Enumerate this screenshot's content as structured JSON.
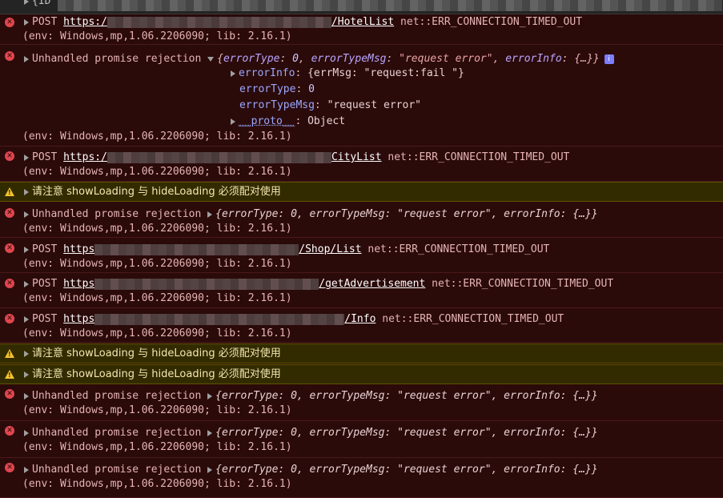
{
  "top_row": {
    "text": "{ID"
  },
  "messages": [
    {
      "type": "error",
      "method": "POST",
      "url_prefix": "https:/",
      "url_suffix": "/HotelList",
      "status": "net::ERR_CONNECTION_TIMED_OUT",
      "env": "(env: Windows,mp,1.06.2206090; lib: 2.16.1)"
    },
    {
      "type": "error",
      "label": "Unhandled promise rejection",
      "summary": {
        "open": "{",
        "k1": "errorType",
        "v1": "0",
        "k2": "errorTypeMsg",
        "v2": "\"request error\"",
        "k3": "errorInfo",
        "v3": "{…}",
        "close": "}"
      },
      "info_icon": "i",
      "expanded": [
        {
          "key": "errorInfo",
          "value": "{errMsg: \"request:fail \"}"
        },
        {
          "key": "errorType",
          "value": "0"
        },
        {
          "key": "errorTypeMsg",
          "value": "\"request error\""
        },
        {
          "key": "__proto__",
          "value": "Object"
        }
      ],
      "env": "(env: Windows,mp,1.06.2206090; lib: 2.16.1)"
    },
    {
      "type": "error",
      "method": "POST",
      "url_prefix": "https:/",
      "url_suffix": "CityList",
      "status": "net::ERR_CONNECTION_TIMED_OUT",
      "env": "(env: Windows,mp,1.06.2206090; lib: 2.16.1)"
    },
    {
      "type": "warning",
      "text": "请注意 showLoading 与 hideLoading 必须配对使用"
    },
    {
      "type": "error",
      "label": "Unhandled promise rejection",
      "summary": "{errorType: 0, errorTypeMsg: \"request error\", errorInfo: {…}}",
      "env": "(env: Windows,mp,1.06.2206090; lib: 2.16.1)"
    },
    {
      "type": "error",
      "method": "POST",
      "url_prefix": "https",
      "url_suffix": "/Shop/List",
      "status": "net::ERR_CONNECTION_TIMED_OUT",
      "env": "(env: Windows,mp,1.06.2206090; lib: 2.16.1)"
    },
    {
      "type": "error",
      "method": "POST",
      "url_prefix": "https",
      "url_suffix": "/getAdvertisement",
      "status": "net::ERR_CONNECTION_TIMED_OUT",
      "env": "(env: Windows,mp,1.06.2206090; lib: 2.16.1)"
    },
    {
      "type": "error",
      "method": "POST",
      "url_prefix": "https",
      "url_suffix": "/Info",
      "status": "net::ERR_CONNECTION_TIMED_OUT",
      "env": "(env: Windows,mp,1.06.2206090; lib: 2.16.1)"
    },
    {
      "type": "warning",
      "text": "请注意 showLoading 与 hideLoading 必须配对使用"
    },
    {
      "type": "warning",
      "text": "请注意 showLoading 与 hideLoading 必须配对使用"
    },
    {
      "type": "error",
      "label": "Unhandled promise rejection",
      "summary": "{errorType: 0, errorTypeMsg: \"request error\", errorInfo: {…}}",
      "env": "(env: Windows,mp,1.06.2206090; lib: 2.16.1)"
    },
    {
      "type": "error",
      "label": "Unhandled promise rejection",
      "summary": "{errorType: 0, errorTypeMsg: \"request error\", errorInfo: {…}}",
      "env": "(env: Windows,mp,1.06.2206090; lib: 2.16.1)"
    },
    {
      "type": "error",
      "label": "Unhandled promise rejection",
      "summary": "{errorType: 0, errorTypeMsg: \"request error\", errorInfo: {…}}",
      "env": "(env: Windows,mp,1.06.2206090; lib: 2.16.1)"
    }
  ],
  "icons": {
    "error": "error-circle-icon",
    "warning": "warning-triangle-icon",
    "expand": "expand-triangle-icon"
  },
  "colors": {
    "error_bg": "#2b0a0a",
    "warning_bg": "#332b00",
    "error_icon": "#e0464e",
    "warning_icon": "#f2c12e"
  }
}
